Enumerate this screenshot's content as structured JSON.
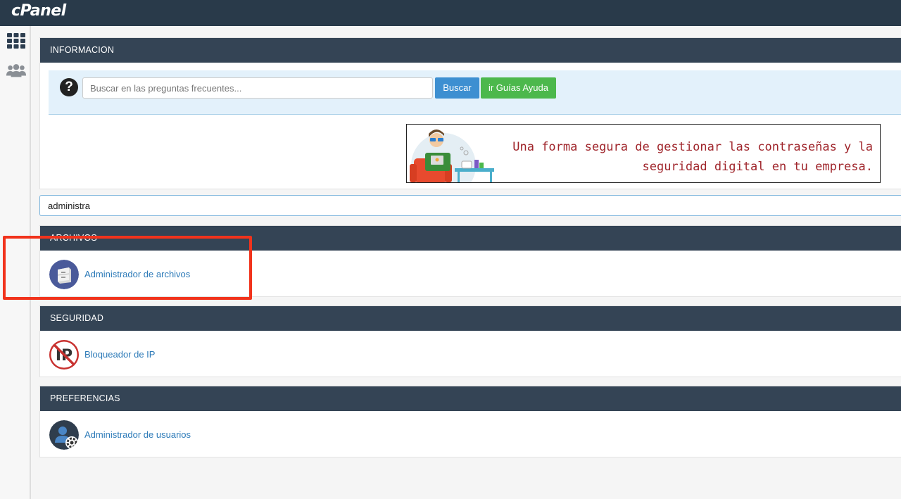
{
  "brand": {
    "logo": "cPanel"
  },
  "sidebar": {
    "items": [
      {
        "icon": "grid-icon"
      },
      {
        "icon": "users-icon"
      }
    ]
  },
  "info": {
    "title": "INFORMACION",
    "search_placeholder": "Buscar en las preguntas frecuentes...",
    "search_button": "Buscar",
    "guides_button": "ir Guías Ayuda",
    "banner_line1": "Una forma segura de gestionar las contraseñas y la",
    "banner_line2": "seguridad digital en tu empresa."
  },
  "filter": {
    "value": "administra"
  },
  "sections": [
    {
      "title": "ARCHIVOS",
      "item": "Administrador de archivos",
      "icon": "file-cabinet-icon"
    },
    {
      "title": "SEGURIDAD",
      "item": "Bloqueador de IP",
      "icon": "ip-blocked-icon"
    },
    {
      "title": "PREFERENCIAS",
      "item": "Administrador de usuarios",
      "icon": "user-manager-icon"
    }
  ],
  "colors": {
    "header": "#293a4a",
    "panel_head": "#344455",
    "link": "#2c7ab8",
    "highlight": "#f1331c"
  }
}
